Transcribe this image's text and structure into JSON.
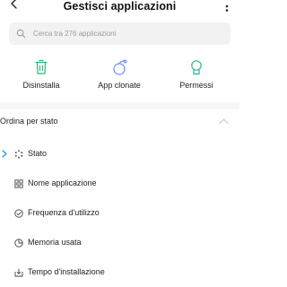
{
  "header": {
    "title": "Gestisci applicazioni"
  },
  "search": {
    "placeholder": "Cerca tra 276 applicazioni"
  },
  "actions": [
    {
      "label": "Disinstalla",
      "icon": "trash-icon",
      "color": "#2bb673"
    },
    {
      "label": "App clonate",
      "icon": "clone-icon",
      "color": "#6d8cf5"
    },
    {
      "label": "Permessi",
      "icon": "shield-icon",
      "color": "#2bb59f"
    }
  ],
  "sort_section": {
    "title": "Ordina per stato",
    "options": [
      {
        "label": "Stato",
        "icon": "loading-dots-icon",
        "selected": true
      },
      {
        "label": "Nome applicazione",
        "icon": "grid-icon",
        "selected": false
      },
      {
        "label": "Frequenza d'utilizzo",
        "icon": "check-circle-icon",
        "selected": false
      },
      {
        "label": "Memoria usata",
        "icon": "pie-icon",
        "selected": false
      },
      {
        "label": "Tempo d'installazione",
        "icon": "download-box-icon",
        "selected": false
      }
    ]
  },
  "colors": {
    "accent": "#1e9bf0",
    "search_bg": "#f2f2f2",
    "divider": "#f7f7f7"
  }
}
